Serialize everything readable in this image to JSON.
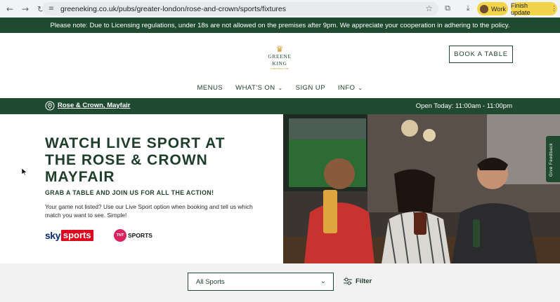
{
  "browser": {
    "url": "greeneking.co.uk/pubs/greater-london/rose-and-crown/sports/fixtures",
    "profile_label": "Work",
    "update_label": "Finish update",
    "icons": [
      "back-icon",
      "forward-icon",
      "reload-icon",
      "site-settings-icon",
      "bookmark-star-icon",
      "extensions-icon",
      "download-icon"
    ]
  },
  "notice": {
    "text": "Please note: Due to Licensing regulations, under 18s are not allowed on the premises after 9pm. We appreciate your cooperation in adhering to the policy."
  },
  "header": {
    "logo_name": "GREENE KING",
    "logo_tag": "PUBS SINCE 1799",
    "book_label": "BOOK A TABLE",
    "nav": [
      {
        "label": "MENUS",
        "dropdown": false
      },
      {
        "label": "WHAT'S ON",
        "dropdown": true
      },
      {
        "label": "SIGN UP",
        "dropdown": false
      },
      {
        "label": "INFO",
        "dropdown": true
      }
    ]
  },
  "location": {
    "name": "Rose & Crown, Mayfair",
    "hours": "Open Today: 11:00am - 11:00pm"
  },
  "hero": {
    "title": "WATCH LIVE SPORT AT THE ROSE & CROWN MAYFAIR",
    "subtitle": "GRAB A TABLE AND JOIN US FOR ALL THE ACTION!",
    "body": "Your game not listed? Use our Live Sport option when booking and tell us which match you want to see. Simple!",
    "sky_prefix": "sky",
    "sky_suffix": "sports",
    "tnt_badge": "TNT",
    "tnt_label": "SPORTS"
  },
  "feedback_label": "Give Feedback",
  "filters": {
    "sport_selected": "All Sports",
    "filter_label": "Filter"
  },
  "colors": {
    "brand_green": "#1f4a30",
    "chip_yellow": "#f3d34a",
    "sky_red": "#e1061d",
    "tnt_pink": "#d9235f"
  }
}
